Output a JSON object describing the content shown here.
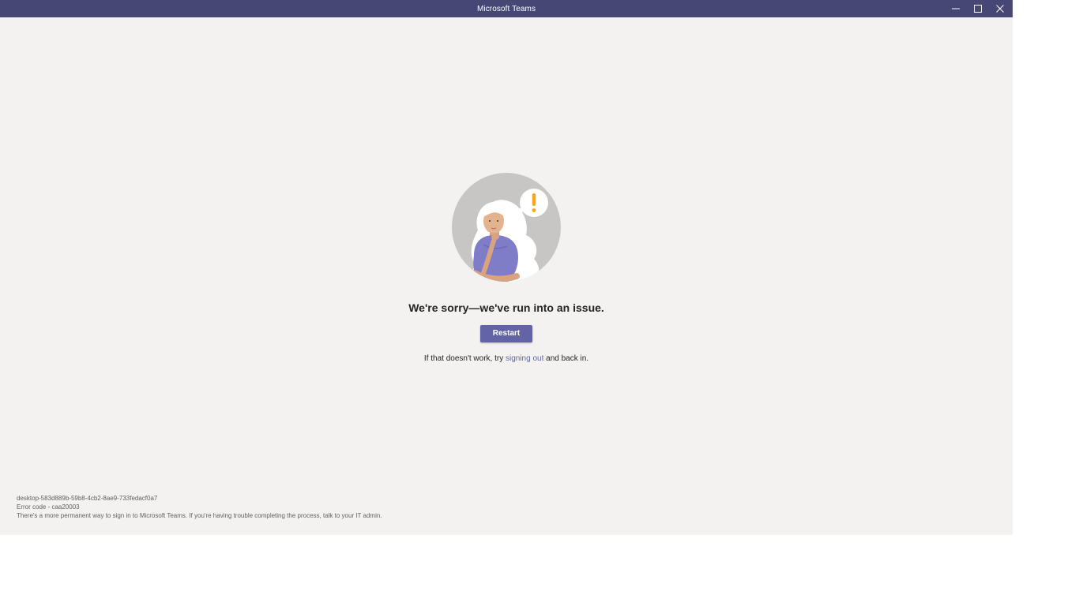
{
  "window": {
    "title": "Microsoft Teams"
  },
  "titlebar_controls": {
    "minimize_icon": "minimize-icon",
    "maximize_icon": "maximize-icon",
    "close_icon": "close-icon"
  },
  "error": {
    "heading": "We're sorry—we've run into an issue.",
    "restart_label": "Restart",
    "hint_prefix": "If that doesn't work, try ",
    "hint_link": "signing out",
    "hint_suffix": " and back in."
  },
  "footer": {
    "session_id": "desktop-583d889b-59b8-4cb2-8ae9-733fedacf0a7",
    "error_code": "Error code - caa20003",
    "info": "There's a more permanent way to sign in to Microsoft Teams. If you're having trouble completing the process, talk to your IT admin."
  },
  "colors": {
    "titlebar": "#464775",
    "background": "#f3f2f1",
    "accent": "#6264a7",
    "warning": "#f8a51a"
  }
}
